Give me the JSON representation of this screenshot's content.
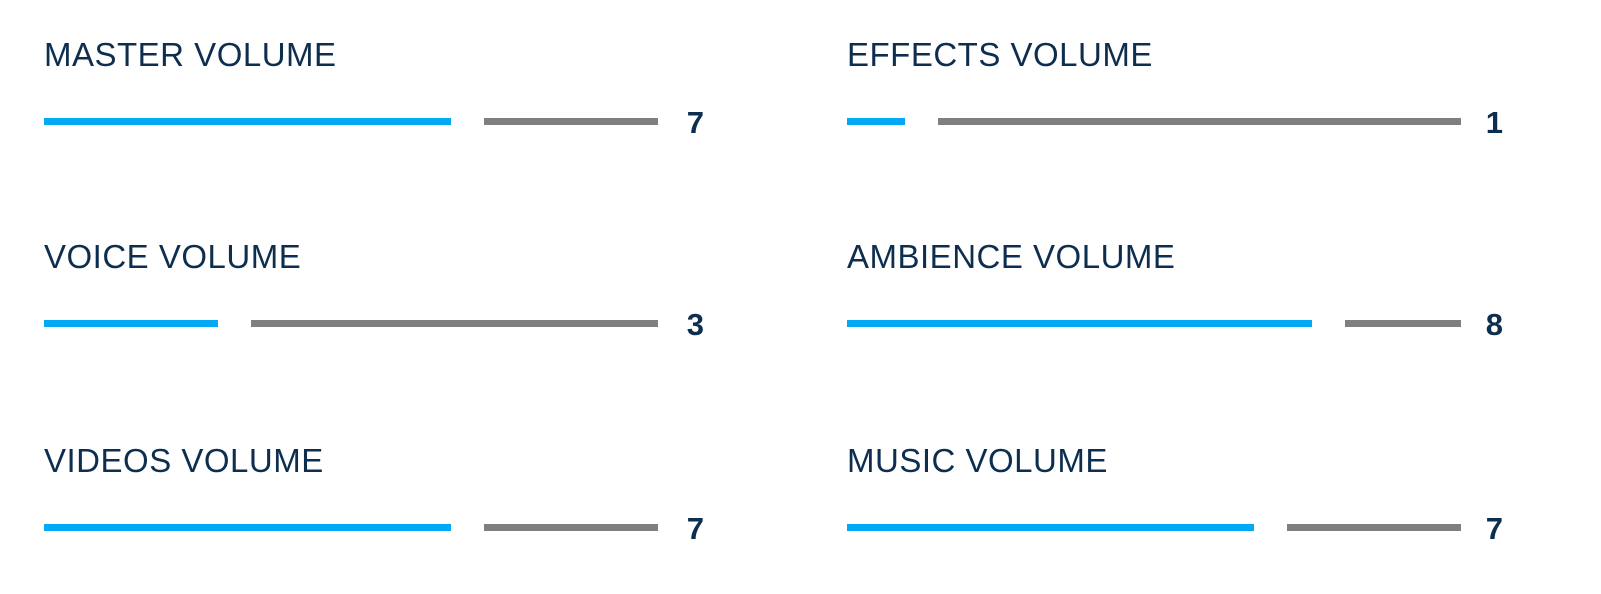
{
  "colors": {
    "label": "#0e2e50",
    "fill": "#03a9f4",
    "track": "#7f7f7f",
    "value": "#0e2e50"
  },
  "sliders": [
    {
      "id": "master",
      "label": "MASTER VOLUME",
      "value": "7",
      "level": 0.7
    },
    {
      "id": "effects",
      "label": "EFFECTS VOLUME",
      "value": "1",
      "level": 0.1
    },
    {
      "id": "voice",
      "label": "VOICE VOLUME",
      "value": "3",
      "level": 0.3
    },
    {
      "id": "ambience",
      "label": "AMBIENCE VOLUME",
      "value": "8",
      "level": 0.8
    },
    {
      "id": "videos",
      "label": "VIDEOS VOLUME",
      "value": "7",
      "level": 0.7
    },
    {
      "id": "music",
      "label": "MUSIC VOLUME",
      "value": "7",
      "level": 0.7
    }
  ]
}
